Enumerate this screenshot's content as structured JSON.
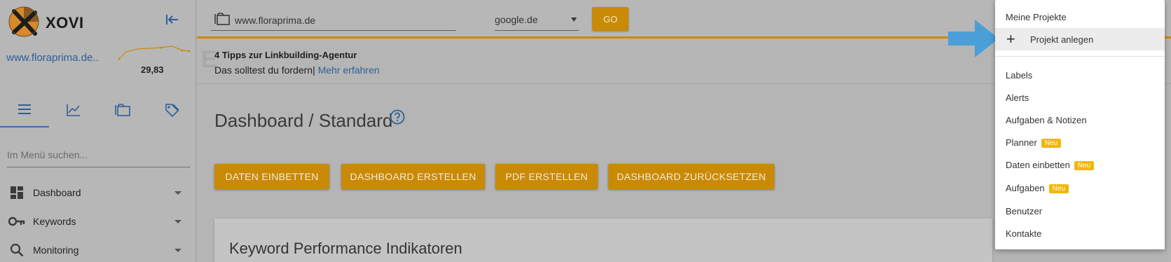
{
  "sidebar": {
    "brand": "XOVI",
    "domain": "www.floraprima.de..",
    "score": "29,83",
    "search_placeholder": "Im Menü suchen...",
    "tabs": [
      {
        "icon": "menu-icon"
      },
      {
        "icon": "chart-icon"
      },
      {
        "icon": "folder-icon"
      },
      {
        "icon": "tag-icon"
      }
    ],
    "items": [
      {
        "label": "Dashboard",
        "icon": "dashboard-icon"
      },
      {
        "label": "Keywords",
        "icon": "key-icon"
      },
      {
        "label": "Monitoring",
        "icon": "search-icon"
      }
    ]
  },
  "topbar": {
    "url_value": "www.floraprima.de",
    "engine": "google.de",
    "go_label": "GO"
  },
  "promo": {
    "title": "4 Tipps zur Linkbuilding-Agentur",
    "text": "Das solltest du fordern|",
    "link": " Mehr erfahren"
  },
  "main": {
    "title": "Dashboard / Standard",
    "buttons": [
      "DATEN EINBETTEN",
      "DASHBOARD ERSTELLEN",
      "PDF ERSTELLEN",
      "DASHBOARD ZURÜCKSETZEN"
    ],
    "card_title": "Keyword Performance Indikatoren"
  },
  "dropdown": {
    "header": "Meine Projekte",
    "create": "Projekt anlegen",
    "items": [
      {
        "label": "Labels",
        "badge": ""
      },
      {
        "label": "Alerts",
        "badge": ""
      },
      {
        "label": "Aufgaben & Notizen",
        "badge": ""
      },
      {
        "label": "Planner",
        "badge": "Neu"
      },
      {
        "label": "Daten einbetten",
        "badge": "Neu"
      },
      {
        "label": "Aufgaben",
        "badge": "Neu"
      },
      {
        "label": "Benutzer",
        "badge": ""
      },
      {
        "label": "Kontakte",
        "badge": ""
      }
    ]
  },
  "colors": {
    "accent": "#c98a07",
    "link": "#2c5f9a",
    "badge": "#f2b705",
    "pointer": "#4a9fd8"
  }
}
